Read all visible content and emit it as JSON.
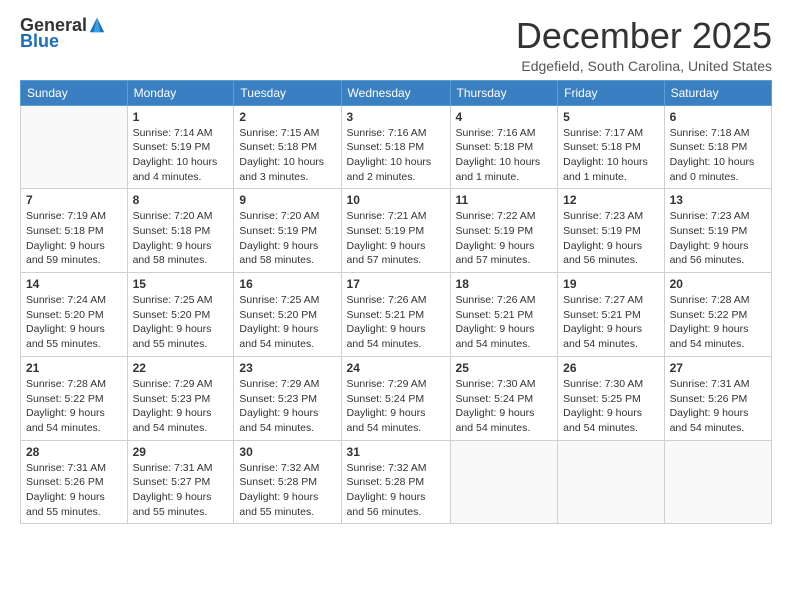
{
  "logo": {
    "general": "General",
    "blue": "Blue"
  },
  "header": {
    "month": "December 2025",
    "location": "Edgefield, South Carolina, United States"
  },
  "days_of_week": [
    "Sunday",
    "Monday",
    "Tuesday",
    "Wednesday",
    "Thursday",
    "Friday",
    "Saturday"
  ],
  "weeks": [
    [
      {
        "num": "",
        "sunrise": "",
        "sunset": "",
        "daylight": ""
      },
      {
        "num": "1",
        "sunrise": "Sunrise: 7:14 AM",
        "sunset": "Sunset: 5:19 PM",
        "daylight": "Daylight: 10 hours and 4 minutes."
      },
      {
        "num": "2",
        "sunrise": "Sunrise: 7:15 AM",
        "sunset": "Sunset: 5:18 PM",
        "daylight": "Daylight: 10 hours and 3 minutes."
      },
      {
        "num": "3",
        "sunrise": "Sunrise: 7:16 AM",
        "sunset": "Sunset: 5:18 PM",
        "daylight": "Daylight: 10 hours and 2 minutes."
      },
      {
        "num": "4",
        "sunrise": "Sunrise: 7:16 AM",
        "sunset": "Sunset: 5:18 PM",
        "daylight": "Daylight: 10 hours and 1 minute."
      },
      {
        "num": "5",
        "sunrise": "Sunrise: 7:17 AM",
        "sunset": "Sunset: 5:18 PM",
        "daylight": "Daylight: 10 hours and 1 minute."
      },
      {
        "num": "6",
        "sunrise": "Sunrise: 7:18 AM",
        "sunset": "Sunset: 5:18 PM",
        "daylight": "Daylight: 10 hours and 0 minutes."
      }
    ],
    [
      {
        "num": "7",
        "sunrise": "Sunrise: 7:19 AM",
        "sunset": "Sunset: 5:18 PM",
        "daylight": "Daylight: 9 hours and 59 minutes."
      },
      {
        "num": "8",
        "sunrise": "Sunrise: 7:20 AM",
        "sunset": "Sunset: 5:18 PM",
        "daylight": "Daylight: 9 hours and 58 minutes."
      },
      {
        "num": "9",
        "sunrise": "Sunrise: 7:20 AM",
        "sunset": "Sunset: 5:19 PM",
        "daylight": "Daylight: 9 hours and 58 minutes."
      },
      {
        "num": "10",
        "sunrise": "Sunrise: 7:21 AM",
        "sunset": "Sunset: 5:19 PM",
        "daylight": "Daylight: 9 hours and 57 minutes."
      },
      {
        "num": "11",
        "sunrise": "Sunrise: 7:22 AM",
        "sunset": "Sunset: 5:19 PM",
        "daylight": "Daylight: 9 hours and 57 minutes."
      },
      {
        "num": "12",
        "sunrise": "Sunrise: 7:23 AM",
        "sunset": "Sunset: 5:19 PM",
        "daylight": "Daylight: 9 hours and 56 minutes."
      },
      {
        "num": "13",
        "sunrise": "Sunrise: 7:23 AM",
        "sunset": "Sunset: 5:19 PM",
        "daylight": "Daylight: 9 hours and 56 minutes."
      }
    ],
    [
      {
        "num": "14",
        "sunrise": "Sunrise: 7:24 AM",
        "sunset": "Sunset: 5:20 PM",
        "daylight": "Daylight: 9 hours and 55 minutes."
      },
      {
        "num": "15",
        "sunrise": "Sunrise: 7:25 AM",
        "sunset": "Sunset: 5:20 PM",
        "daylight": "Daylight: 9 hours and 55 minutes."
      },
      {
        "num": "16",
        "sunrise": "Sunrise: 7:25 AM",
        "sunset": "Sunset: 5:20 PM",
        "daylight": "Daylight: 9 hours and 54 minutes."
      },
      {
        "num": "17",
        "sunrise": "Sunrise: 7:26 AM",
        "sunset": "Sunset: 5:21 PM",
        "daylight": "Daylight: 9 hours and 54 minutes."
      },
      {
        "num": "18",
        "sunrise": "Sunrise: 7:26 AM",
        "sunset": "Sunset: 5:21 PM",
        "daylight": "Daylight: 9 hours and 54 minutes."
      },
      {
        "num": "19",
        "sunrise": "Sunrise: 7:27 AM",
        "sunset": "Sunset: 5:21 PM",
        "daylight": "Daylight: 9 hours and 54 minutes."
      },
      {
        "num": "20",
        "sunrise": "Sunrise: 7:28 AM",
        "sunset": "Sunset: 5:22 PM",
        "daylight": "Daylight: 9 hours and 54 minutes."
      }
    ],
    [
      {
        "num": "21",
        "sunrise": "Sunrise: 7:28 AM",
        "sunset": "Sunset: 5:22 PM",
        "daylight": "Daylight: 9 hours and 54 minutes."
      },
      {
        "num": "22",
        "sunrise": "Sunrise: 7:29 AM",
        "sunset": "Sunset: 5:23 PM",
        "daylight": "Daylight: 9 hours and 54 minutes."
      },
      {
        "num": "23",
        "sunrise": "Sunrise: 7:29 AM",
        "sunset": "Sunset: 5:23 PM",
        "daylight": "Daylight: 9 hours and 54 minutes."
      },
      {
        "num": "24",
        "sunrise": "Sunrise: 7:29 AM",
        "sunset": "Sunset: 5:24 PM",
        "daylight": "Daylight: 9 hours and 54 minutes."
      },
      {
        "num": "25",
        "sunrise": "Sunrise: 7:30 AM",
        "sunset": "Sunset: 5:24 PM",
        "daylight": "Daylight: 9 hours and 54 minutes."
      },
      {
        "num": "26",
        "sunrise": "Sunrise: 7:30 AM",
        "sunset": "Sunset: 5:25 PM",
        "daylight": "Daylight: 9 hours and 54 minutes."
      },
      {
        "num": "27",
        "sunrise": "Sunrise: 7:31 AM",
        "sunset": "Sunset: 5:26 PM",
        "daylight": "Daylight: 9 hours and 54 minutes."
      }
    ],
    [
      {
        "num": "28",
        "sunrise": "Sunrise: 7:31 AM",
        "sunset": "Sunset: 5:26 PM",
        "daylight": "Daylight: 9 hours and 55 minutes."
      },
      {
        "num": "29",
        "sunrise": "Sunrise: 7:31 AM",
        "sunset": "Sunset: 5:27 PM",
        "daylight": "Daylight: 9 hours and 55 minutes."
      },
      {
        "num": "30",
        "sunrise": "Sunrise: 7:32 AM",
        "sunset": "Sunset: 5:28 PM",
        "daylight": "Daylight: 9 hours and 55 minutes."
      },
      {
        "num": "31",
        "sunrise": "Sunrise: 7:32 AM",
        "sunset": "Sunset: 5:28 PM",
        "daylight": "Daylight: 9 hours and 56 minutes."
      },
      {
        "num": "",
        "sunrise": "",
        "sunset": "",
        "daylight": ""
      },
      {
        "num": "",
        "sunrise": "",
        "sunset": "",
        "daylight": ""
      },
      {
        "num": "",
        "sunrise": "",
        "sunset": "",
        "daylight": ""
      }
    ]
  ]
}
